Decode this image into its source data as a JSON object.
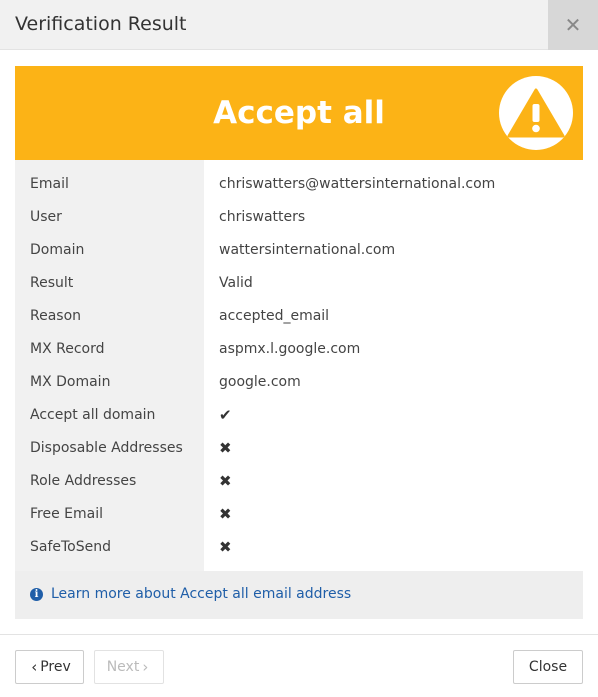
{
  "dialog": {
    "title": "Verification Result",
    "close_icon": "close-icon"
  },
  "banner": {
    "title": "Accept all",
    "color": "#fcb316",
    "icon": "warning-icon"
  },
  "details": {
    "rows": [
      {
        "label": "Email",
        "value": "chriswatters@wattersinternational.com"
      },
      {
        "label": "User",
        "value": "chriswatters"
      },
      {
        "label": "Domain",
        "value": "wattersinternational.com"
      },
      {
        "label": "Result",
        "value": "Valid"
      },
      {
        "label": "Reason",
        "value": "accepted_email"
      },
      {
        "label": "MX Record",
        "value": "aspmx.l.google.com"
      },
      {
        "label": "MX Domain",
        "value": "google.com"
      },
      {
        "label": "Accept all domain",
        "value": "✔",
        "icon": "check-icon"
      },
      {
        "label": "Disposable Addresses",
        "value": "✖",
        "icon": "cross-icon"
      },
      {
        "label": "Role Addresses",
        "value": "✖",
        "icon": "cross-icon"
      },
      {
        "label": "Free Email",
        "value": "✖",
        "icon": "cross-icon"
      },
      {
        "label": "SafeToSend",
        "value": "✖",
        "icon": "cross-icon"
      }
    ]
  },
  "info": {
    "icon": "info-icon",
    "link_text": "Learn more about Accept all email address"
  },
  "footer": {
    "prev_label": "Prev",
    "next_label": "Next",
    "close_label": "Close"
  }
}
